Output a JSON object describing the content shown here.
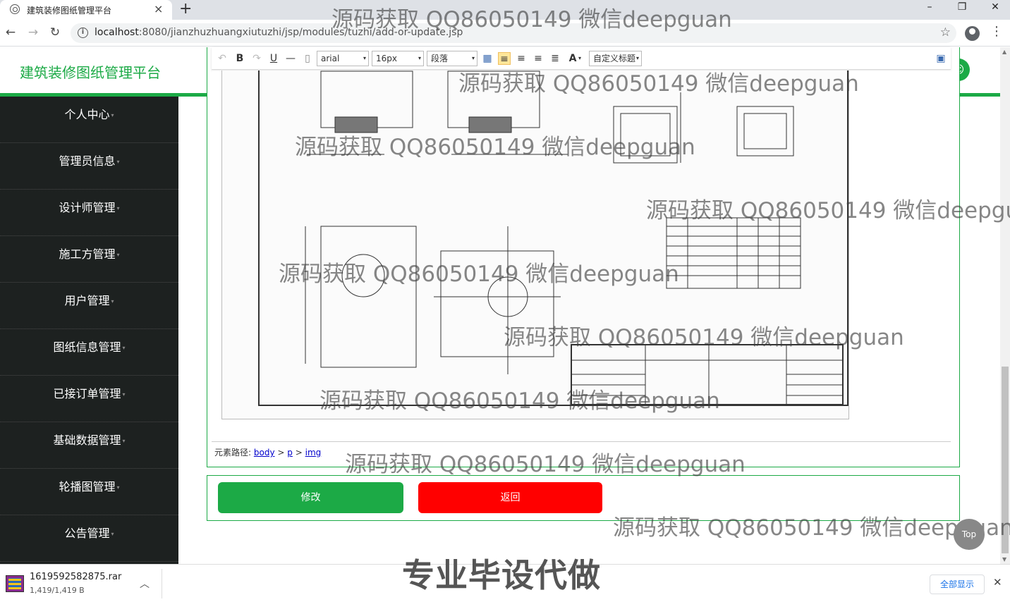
{
  "browser": {
    "tab_title": "建筑装修图纸管理平台",
    "url_host": "localhost",
    "url_rest": ":8080/jianzhuzhuangxiutuzhi/jsp/modules/tuzhi/add-or-update.jsp"
  },
  "header": {
    "brand": "建筑装修图纸管理平台"
  },
  "sidebar": {
    "items": [
      {
        "label": "个人中心"
      },
      {
        "label": "管理员信息"
      },
      {
        "label": "设计师管理"
      },
      {
        "label": "施工方管理"
      },
      {
        "label": "用户管理"
      },
      {
        "label": "图纸信息管理"
      },
      {
        "label": "已接订单管理"
      },
      {
        "label": "基础数据管理"
      },
      {
        "label": "轮播图管理"
      },
      {
        "label": "公告管理"
      }
    ]
  },
  "editor": {
    "font_family": "arial",
    "font_size": "16px",
    "paragraph": "段落",
    "custom_title": "自定义标题",
    "path_label": "元素路径:",
    "path_body": "body",
    "path_p": "p",
    "path_img": "img",
    "sep": ">"
  },
  "actions": {
    "save_label": "修改",
    "back_label": "返回",
    "top_label": "Top"
  },
  "download": {
    "filename": "1619592582875.rar",
    "size": "1,419/1,419 B",
    "show_all": "全部显示"
  },
  "overlay": {
    "watermark": "源码获取 QQ86050149 微信deepguan",
    "promo": "专业毕设代做"
  }
}
